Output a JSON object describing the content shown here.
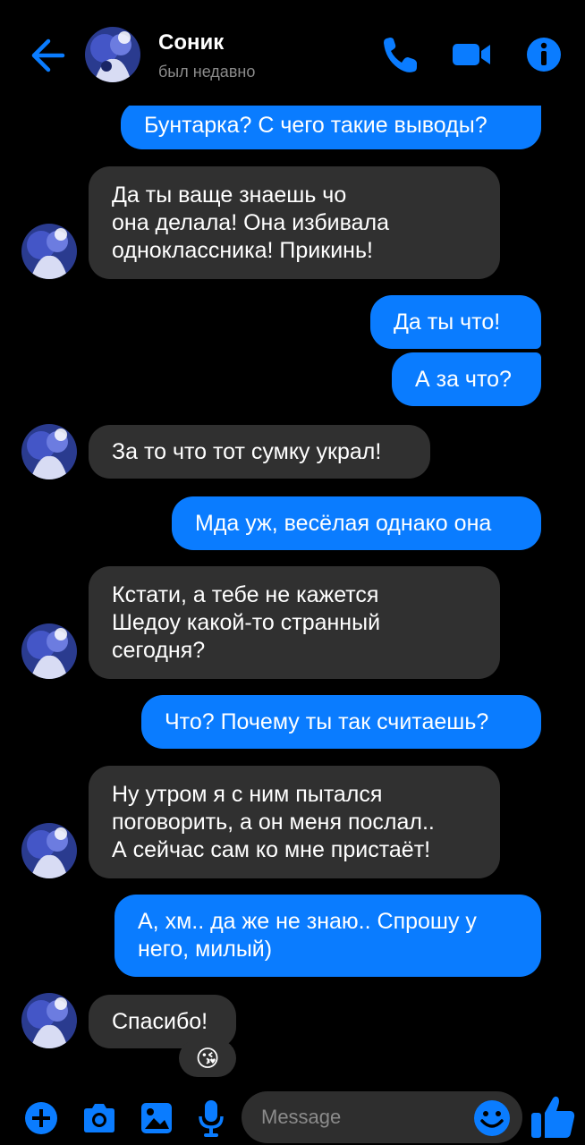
{
  "contact": {
    "name": "Соник",
    "status": "был недавно"
  },
  "colors": {
    "accent": "#0a7cff",
    "incoming_bubble": "#303030",
    "background": "#000000"
  },
  "header_icons": [
    "back-arrow-icon",
    "phone-icon",
    "video-icon",
    "info-icon"
  ],
  "messages": [
    {
      "direction": "outgoing",
      "text": "Бунтарка? С чего такие выводы?"
    },
    {
      "direction": "incoming",
      "text": "Да ты ваще знаешь чо\nона делала! Она избивала\nодноклассника! Прикинь!"
    },
    {
      "direction": "outgoing",
      "text": "Да ты что!"
    },
    {
      "direction": "outgoing",
      "text": "А за что?"
    },
    {
      "direction": "incoming",
      "text": "За то что тот сумку украл!"
    },
    {
      "direction": "outgoing",
      "text": "Мда уж, весёлая однако она"
    },
    {
      "direction": "incoming",
      "text": "Кстати, а тебе не кажется\nШедоу какой-то странный\nсегодня?"
    },
    {
      "direction": "outgoing",
      "text": "Что? Почему ты так считаешь?"
    },
    {
      "direction": "incoming",
      "text": "Ну утром я с ним пытался\nпоговорить, а он меня послал..\nА сейчас сам ко мне пристаёт!"
    },
    {
      "direction": "outgoing",
      "text": "А, хм.. да же не знаю.. Спрошу у\nнего, милый)"
    },
    {
      "direction": "incoming",
      "text": "Спасибо!",
      "reaction": "😘"
    }
  ],
  "composer": {
    "placeholder": "Message",
    "icons": [
      "plus-icon",
      "camera-icon",
      "gallery-icon",
      "microphone-icon",
      "emoji-icon",
      "thumbs-up-icon"
    ]
  }
}
